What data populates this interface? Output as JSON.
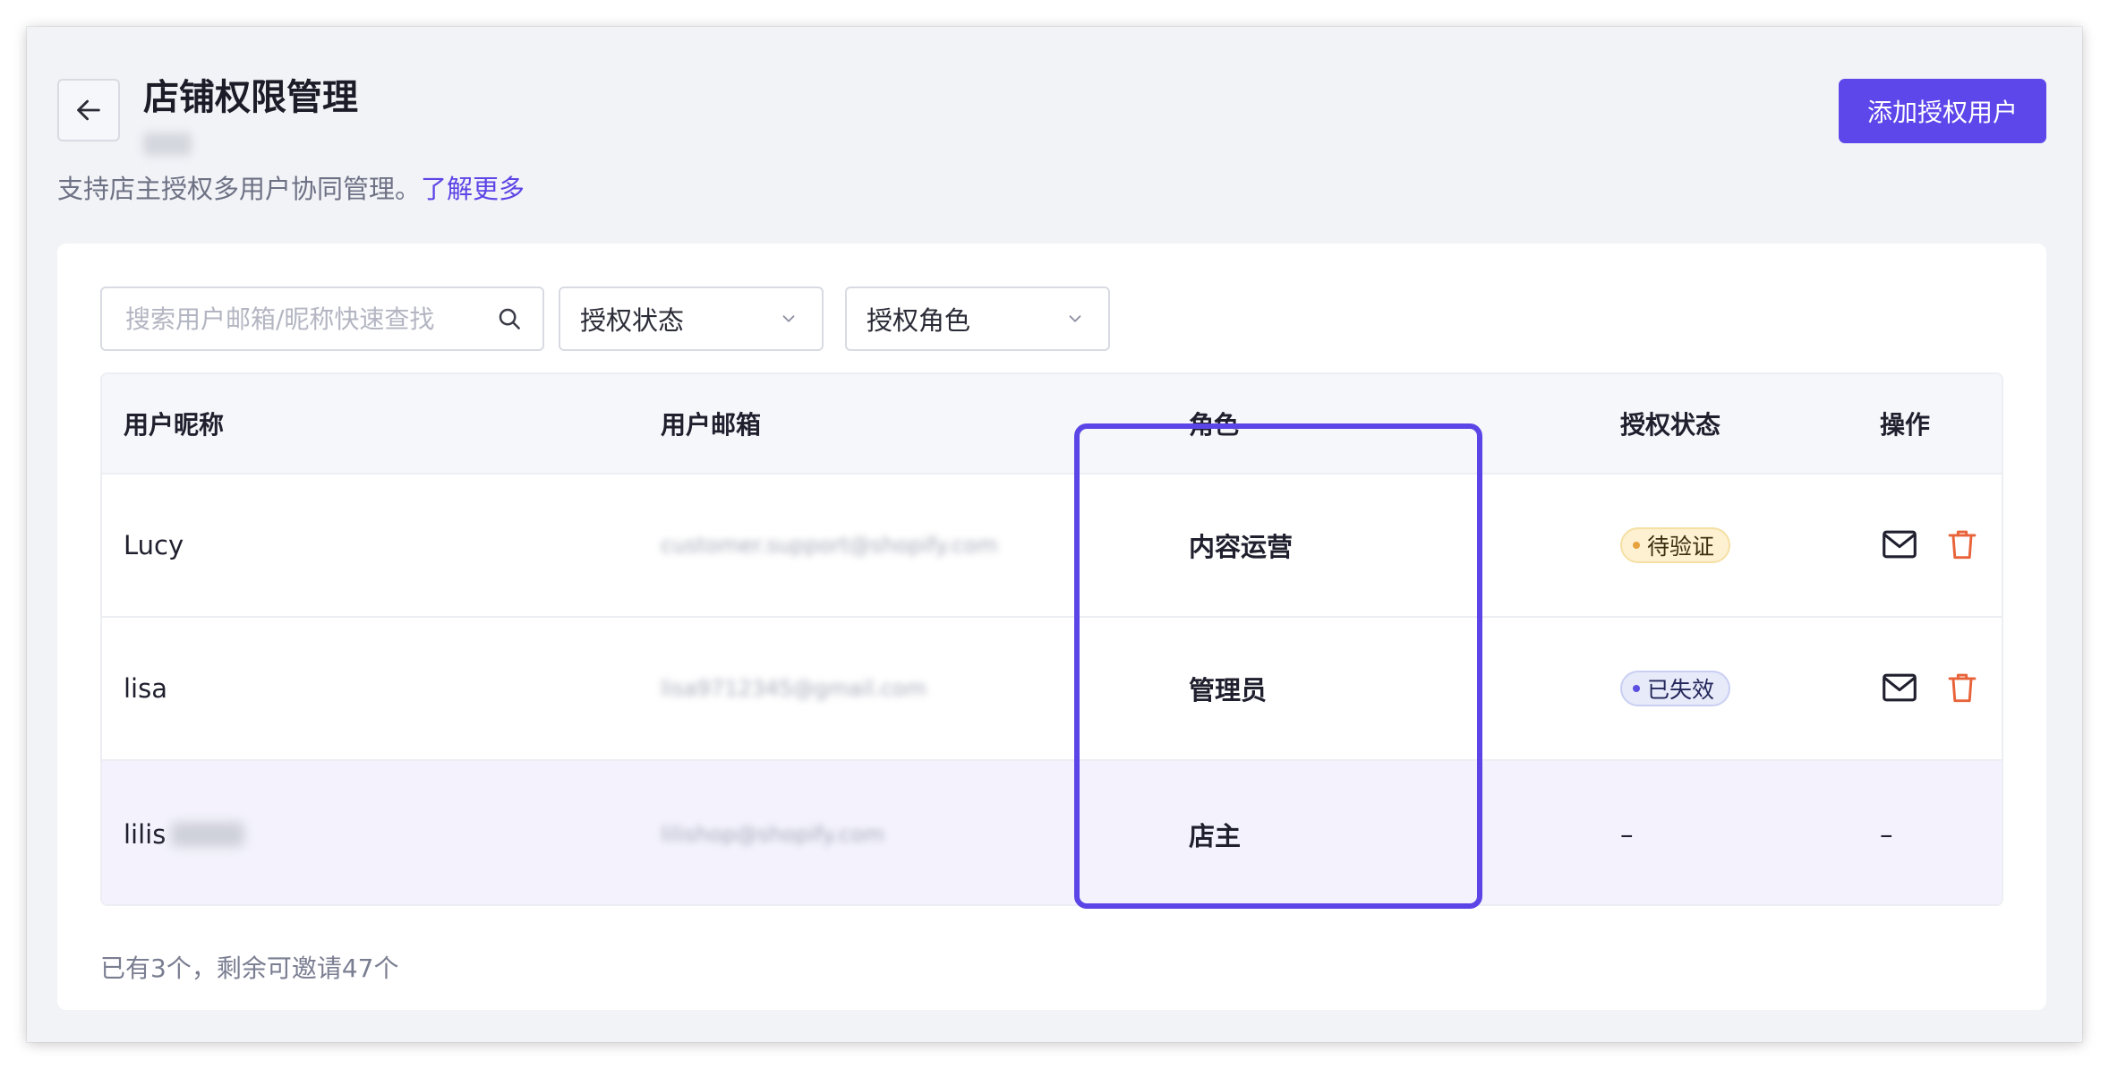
{
  "header": {
    "title": "店铺权限管理",
    "subtitle": "支持店主授权多用户协同管理。",
    "learn_more": "了解更多",
    "add_button": "添加授权用户"
  },
  "filters": {
    "search_placeholder": "搜索用户邮箱/昵称快速查找",
    "status_select": "授权状态",
    "role_select": "授权角色"
  },
  "table": {
    "columns": [
      "用户昵称",
      "用户邮箱",
      "角色",
      "授权状态",
      "操作"
    ],
    "rows": [
      {
        "nickname": "Lucy",
        "email": "customer.support@shopify.com",
        "role": "内容运营",
        "status": "待验证",
        "status_kind": "pending",
        "actions": [
          "mail-icon",
          "trash-icon"
        ]
      },
      {
        "nickname": "lisa",
        "email": "lisa9712345@gmail.com",
        "role": "管理员",
        "status": "已失效",
        "status_kind": "expired",
        "actions": [
          "mail-icon",
          "trash-icon"
        ]
      },
      {
        "nickname": "lilis",
        "email": "lilishop@shopify.com",
        "role": "店主",
        "status": "–",
        "status_kind": "none",
        "action_text": "–"
      }
    ]
  },
  "footer": {
    "summary": "已有3个，剩余可邀请47个"
  },
  "colors": {
    "accent": "#5d47ea",
    "highlight_border": "#5b45e6",
    "delete_icon": "#e8633a",
    "pending_badge": "#fdf1d2",
    "expired_badge": "#e7eaf9"
  }
}
